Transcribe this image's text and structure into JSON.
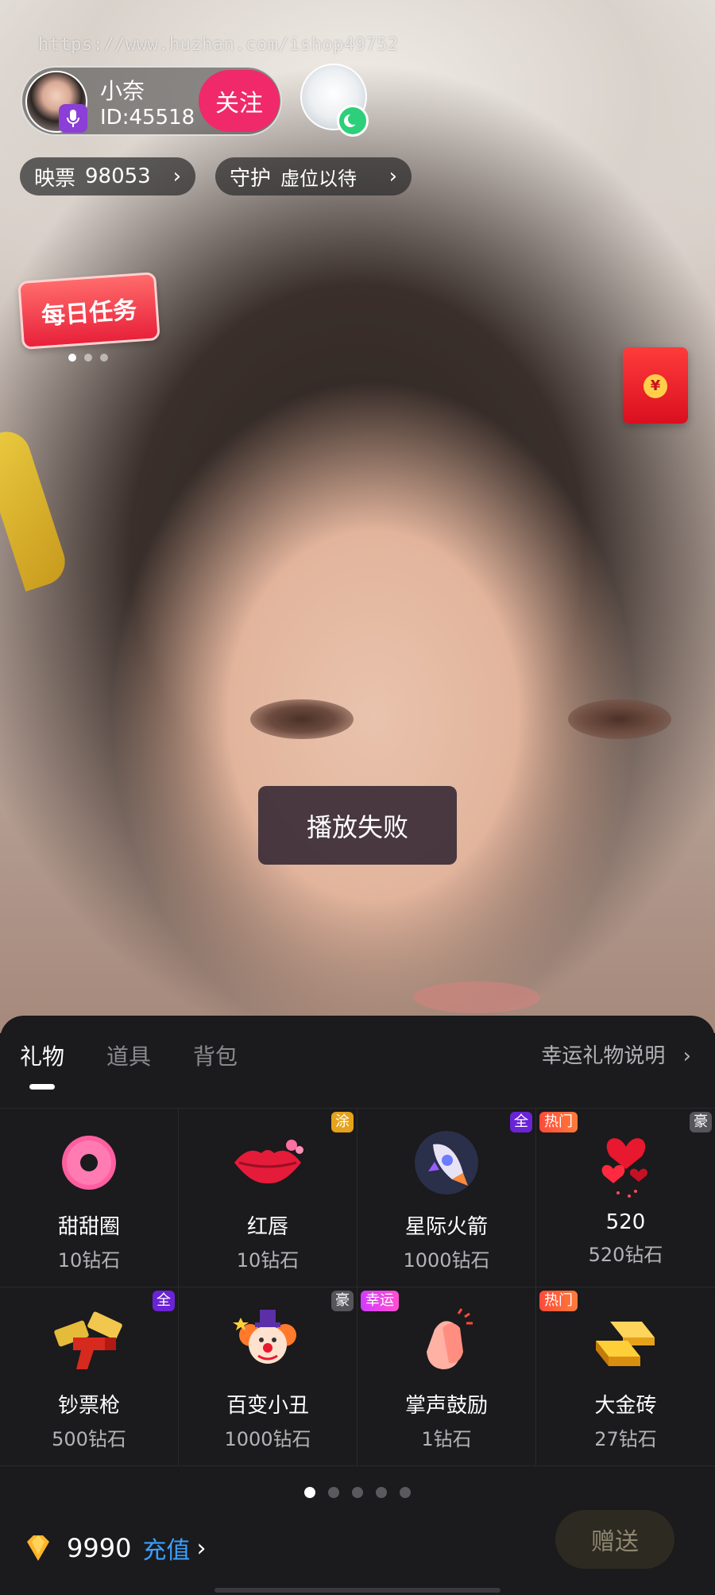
{
  "watermark": "https://www.huzhan.com/ishop49752",
  "host": {
    "name": "小奈",
    "id": "ID:45518",
    "follow_label": "关注"
  },
  "votes": {
    "label": "映票",
    "value": "98053"
  },
  "guard": {
    "label": "守护",
    "value": "虚位以待"
  },
  "daily_task": {
    "label": "每日任务"
  },
  "toast": {
    "message": "播放失败"
  },
  "panel": {
    "tabs": [
      {
        "label": "礼物",
        "active": true
      },
      {
        "label": "道具",
        "active": false
      },
      {
        "label": "背包",
        "active": false
      }
    ],
    "lucky_link": "幸运礼物说明",
    "gifts": [
      {
        "name": "甜甜圈",
        "price": "10钻石",
        "badge": "",
        "icon": "donut-icon"
      },
      {
        "name": "红唇",
        "price": "10钻石",
        "badge": "涂",
        "icon": "lips-icon"
      },
      {
        "name": "星际火箭",
        "price": "1000钻石",
        "badge": "全",
        "icon": "rocket-icon"
      },
      {
        "name": "520",
        "price": "520钻石",
        "badge": "热门",
        "badge2": "豪",
        "icon": "hearts-icon"
      },
      {
        "name": "钞票枪",
        "price": "500钻石",
        "badge": "全",
        "icon": "money-gun-icon"
      },
      {
        "name": "百变小丑",
        "price": "1000钻石",
        "badge": "豪",
        "icon": "clown-icon"
      },
      {
        "name": "掌声鼓励",
        "price": "1钻石",
        "badge": "幸运",
        "icon": "clap-icon"
      },
      {
        "name": "大金砖",
        "price": "27钻石",
        "badge": "热门",
        "icon": "gold-bar-icon"
      }
    ],
    "balance": "9990",
    "recharge_label": "充值",
    "send_label": "赠送"
  },
  "colors": {
    "follow": "#f0296a",
    "recharge": "#3aa0ff",
    "panel_bg": "#1b1a1c"
  }
}
